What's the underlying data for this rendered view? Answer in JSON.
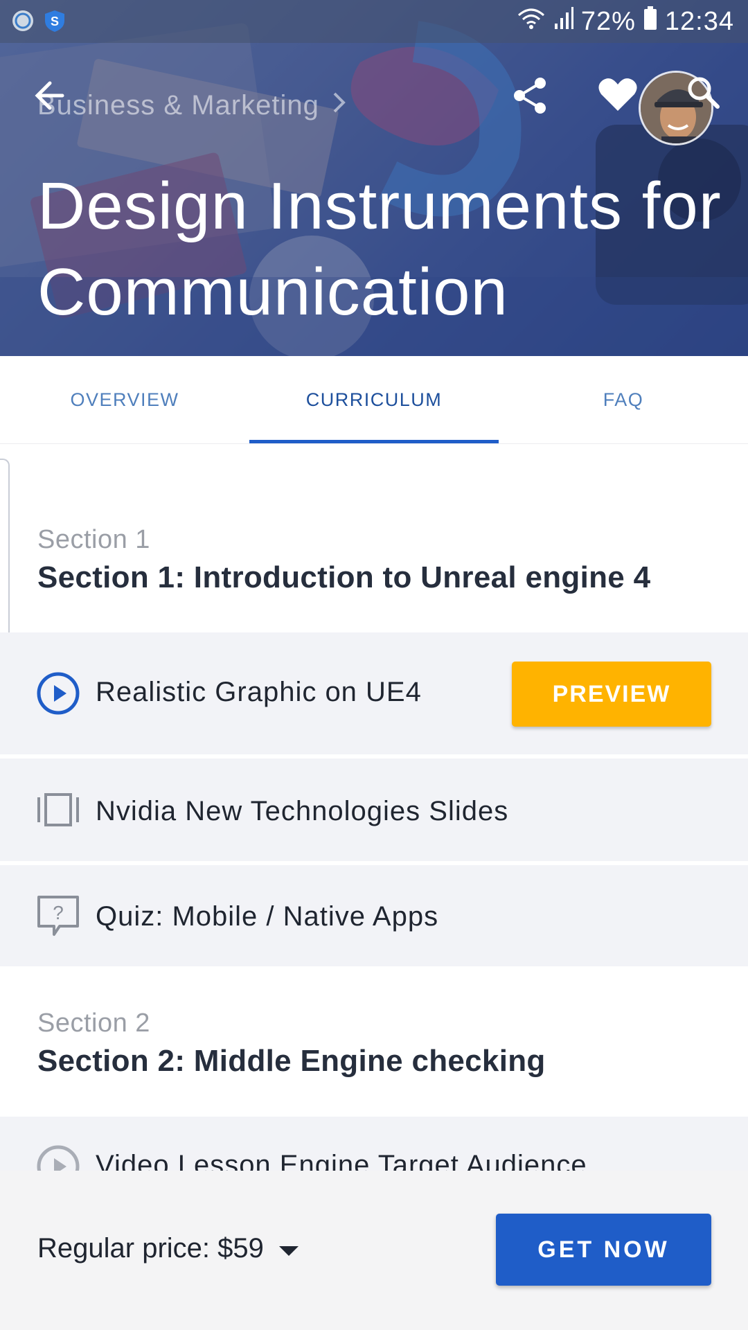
{
  "status_bar": {
    "battery": "72%",
    "time": "12:34"
  },
  "header": {
    "breadcrumb": "Business & Marketing",
    "title": "Design Instruments for Communication"
  },
  "tabs": [
    {
      "label": "OVERVIEW",
      "active": false
    },
    {
      "label": "CURRICULUM",
      "active": true
    },
    {
      "label": "FAQ",
      "active": false
    }
  ],
  "curriculum": {
    "sections": [
      {
        "label": "Section 1",
        "title": "Section 1: Introduction to Unreal engine 4",
        "lessons": [
          {
            "icon": "play-circle-icon",
            "title": "Realistic Graphic on UE4",
            "action": "PREVIEW"
          },
          {
            "icon": "slides-icon",
            "title": "Nvidia New Technologies Slides"
          },
          {
            "icon": "quiz-icon",
            "title": "Quiz: Mobile / Native Apps"
          }
        ]
      },
      {
        "label": "Section 2",
        "title": "Section 2: Middle Engine checking",
        "lessons": [
          {
            "icon": "play-circle-icon",
            "title": "Video Lesson Engine Target Audience"
          }
        ]
      }
    ]
  },
  "footer": {
    "price": "Regular price: $59",
    "cta": "GET NOW"
  },
  "colors": {
    "primary": "#1f5dc8",
    "accent": "#ffb300",
    "tab_text": "#4f7fbc",
    "heading_dark": "#262e3d",
    "lesson_bg": "#f2f3f7"
  }
}
